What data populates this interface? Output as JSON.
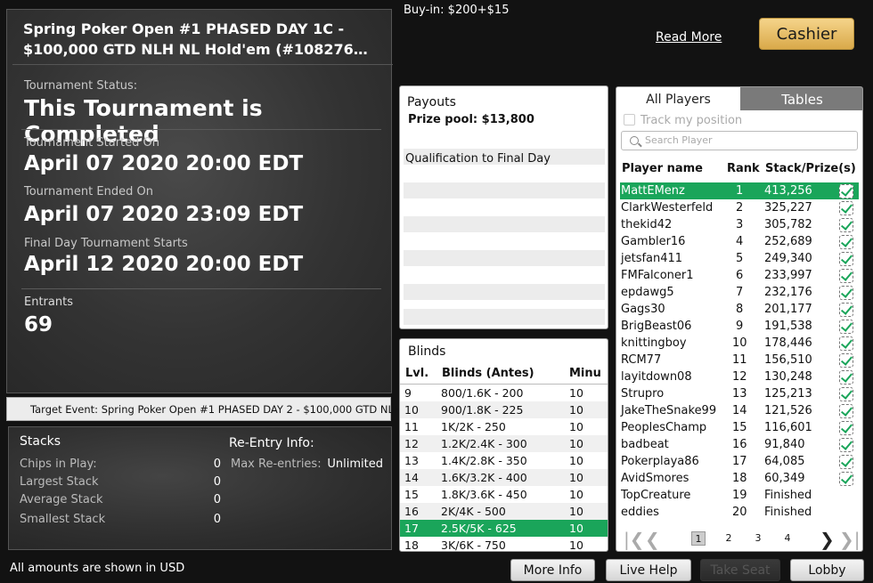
{
  "tournament": {
    "title_line1": "Spring Poker Open #1 PHASED DAY 1C -",
    "title_line2": "$100,000 GTD NLH NL Hold'em (#108276…",
    "status_label": "Tournament Status:",
    "status_value": "This Tournament is Completed",
    "started_label": "Tournament Started On",
    "started_value": "April 07 2020 20:00 EDT",
    "ended_label": "Tournament Ended On",
    "ended_value": "April 07 2020 23:09 EDT",
    "final_label": "Final Day Tournament Starts",
    "final_value": "April 12 2020 20:00 EDT",
    "entrants_label": "Entrants",
    "entrants_value": "69"
  },
  "target_event": "Target Event: Spring Poker Open #1 PHASED DAY 2 - $100,000 GTD NLH",
  "stacks": {
    "header": "Stacks",
    "chips_label": "Chips in Play:",
    "chips_value": "0",
    "largest_label": "Largest Stack",
    "largest_value": "0",
    "average_label": "Average Stack",
    "average_value": "0",
    "smallest_label": "Smallest Stack",
    "smallest_value": "0"
  },
  "reentry": {
    "header": "Re-Entry Info:",
    "max_label": "Max Re-entries:",
    "max_value": "Unlimited"
  },
  "footer_note": "All amounts are shown in USD",
  "buyin": "Buy-in: $200+$15",
  "read_more": "Read More",
  "cashier": "Cashier",
  "payouts": {
    "header": "Payouts",
    "prize_pool": "Prize pool: $13,800",
    "qualification": "Qualification to Final Day"
  },
  "blinds": {
    "header": "Blinds",
    "col_level": "Lvl.",
    "col_blinds": "Blinds (Antes)",
    "col_minutes": "Minu",
    "rows": [
      {
        "lvl": "9",
        "blinds": "800/1.6K - 200",
        "min": "10"
      },
      {
        "lvl": "10",
        "blinds": "900/1.8K - 225",
        "min": "10"
      },
      {
        "lvl": "11",
        "blinds": "1K/2K - 250",
        "min": "10"
      },
      {
        "lvl": "12",
        "blinds": "1.2K/2.4K - 300",
        "min": "10"
      },
      {
        "lvl": "13",
        "blinds": "1.4K/2.8K - 350",
        "min": "10"
      },
      {
        "lvl": "14",
        "blinds": "1.6K/3.2K - 400",
        "min": "10"
      },
      {
        "lvl": "15",
        "blinds": "1.8K/3.6K - 450",
        "min": "10"
      },
      {
        "lvl": "16",
        "blinds": "2K/4K - 500",
        "min": "10"
      },
      {
        "lvl": "17",
        "blinds": "2.5K/5K - 625",
        "min": "10"
      },
      {
        "lvl": "18",
        "blinds": "3K/6K - 750",
        "min": "10"
      }
    ]
  },
  "players": {
    "tab_all": "All Players",
    "tab_tables": "Tables",
    "track_label": "Track my position",
    "search_placeholder": "Search Player",
    "col_name": "Player name",
    "col_rank": "Rank",
    "col_stack": "Stack/Prize(s)",
    "rows": [
      {
        "name": "MattEMenz",
        "rank": "1",
        "stack": "413,256",
        "check": true
      },
      {
        "name": "ClarkWesterfeld",
        "rank": "2",
        "stack": "325,227",
        "check": true
      },
      {
        "name": "thekid42",
        "rank": "3",
        "stack": "305,782",
        "check": true
      },
      {
        "name": "Gambler16",
        "rank": "4",
        "stack": "252,689",
        "check": true
      },
      {
        "name": "jetsfan411",
        "rank": "5",
        "stack": "249,340",
        "check": true
      },
      {
        "name": "FMFalconer1",
        "rank": "6",
        "stack": "233,997",
        "check": true
      },
      {
        "name": "epdawg5",
        "rank": "7",
        "stack": "232,176",
        "check": true
      },
      {
        "name": "Gags30",
        "rank": "8",
        "stack": "201,177",
        "check": true
      },
      {
        "name": "BrigBeast06",
        "rank": "9",
        "stack": "191,538",
        "check": true
      },
      {
        "name": "knittingboy",
        "rank": "10",
        "stack": "178,446",
        "check": true
      },
      {
        "name": "RCM77",
        "rank": "11",
        "stack": "156,510",
        "check": true
      },
      {
        "name": "layitdown08",
        "rank": "12",
        "stack": "130,248",
        "check": true
      },
      {
        "name": "Strupro",
        "rank": "13",
        "stack": "125,213",
        "check": true
      },
      {
        "name": "JakeTheSnake99",
        "rank": "14",
        "stack": "121,526",
        "check": true
      },
      {
        "name": "PeoplesChamp",
        "rank": "15",
        "stack": "116,601",
        "check": true
      },
      {
        "name": "badbeat",
        "rank": "16",
        "stack": "91,840",
        "check": true
      },
      {
        "name": "Pokerplaya86",
        "rank": "17",
        "stack": "64,085",
        "check": true
      },
      {
        "name": "AvidSmores",
        "rank": "18",
        "stack": "60,349",
        "check": true
      },
      {
        "name": "TopCreature",
        "rank": "19",
        "stack": "Finished",
        "check": false
      },
      {
        "name": "eddies",
        "rank": "20",
        "stack": "Finished",
        "check": false
      }
    ],
    "pages": [
      "1",
      "2",
      "3",
      "4"
    ]
  },
  "buttons": {
    "more_info": "More Info",
    "live_help": "Live Help",
    "take_seat": "Take Seat",
    "lobby": "Lobby"
  },
  "colors": {
    "highlight": "#1aa55a",
    "cashier": "#e8c06a"
  }
}
